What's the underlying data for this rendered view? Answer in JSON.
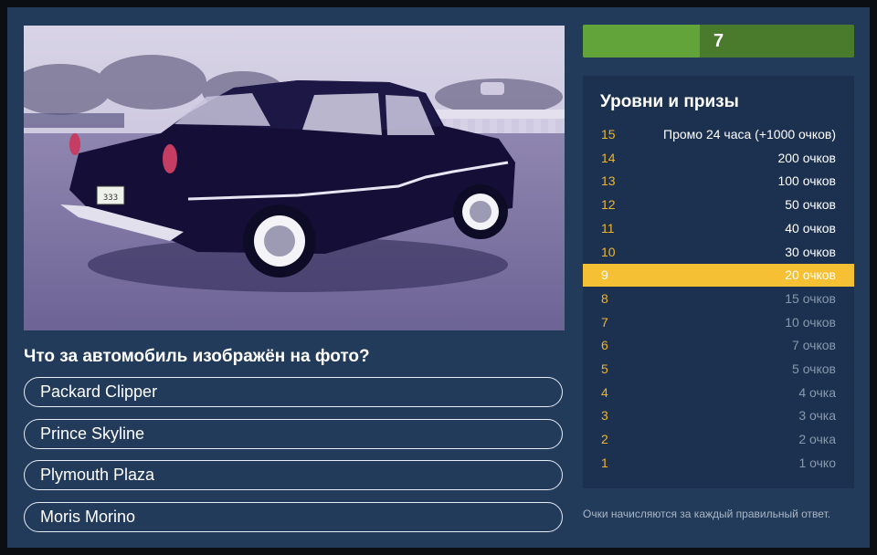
{
  "question": "Что за автомобиль изображён на фото?",
  "answers": [
    "Packard Clipper",
    "Prince Skyline",
    "Plymouth Plaza",
    "Moris Morino"
  ],
  "timer": {
    "value": "7",
    "fraction_remaining": 0.43
  },
  "levels": {
    "title": "Уровни и призы",
    "current_level": 9,
    "items": [
      {
        "level": "15",
        "prize": "Промо 24 часа (+1000 очков)"
      },
      {
        "level": "14",
        "prize": "200 очков"
      },
      {
        "level": "13",
        "prize": "100 очков"
      },
      {
        "level": "12",
        "prize": "50 очков"
      },
      {
        "level": "11",
        "prize": "40 очков"
      },
      {
        "level": "10",
        "prize": "30 очков"
      },
      {
        "level": "9",
        "prize": "20 очков"
      },
      {
        "level": "8",
        "prize": "15 очков"
      },
      {
        "level": "7",
        "prize": "10 очков"
      },
      {
        "level": "6",
        "prize": "7 очков"
      },
      {
        "level": "5",
        "prize": "5 очков"
      },
      {
        "level": "4",
        "prize": "4 очка"
      },
      {
        "level": "3",
        "prize": "3 очка"
      },
      {
        "level": "2",
        "prize": "2 очка"
      },
      {
        "level": "1",
        "prize": "1 очко"
      }
    ]
  },
  "photo": {
    "plate_text": "333"
  },
  "note": "Очки начисляются за каждый правильный ответ.",
  "colors": {
    "background": "#223b5a",
    "accent_level": "#f5c033",
    "level_number": "#f0b429",
    "timer_green": "#62a33a"
  }
}
